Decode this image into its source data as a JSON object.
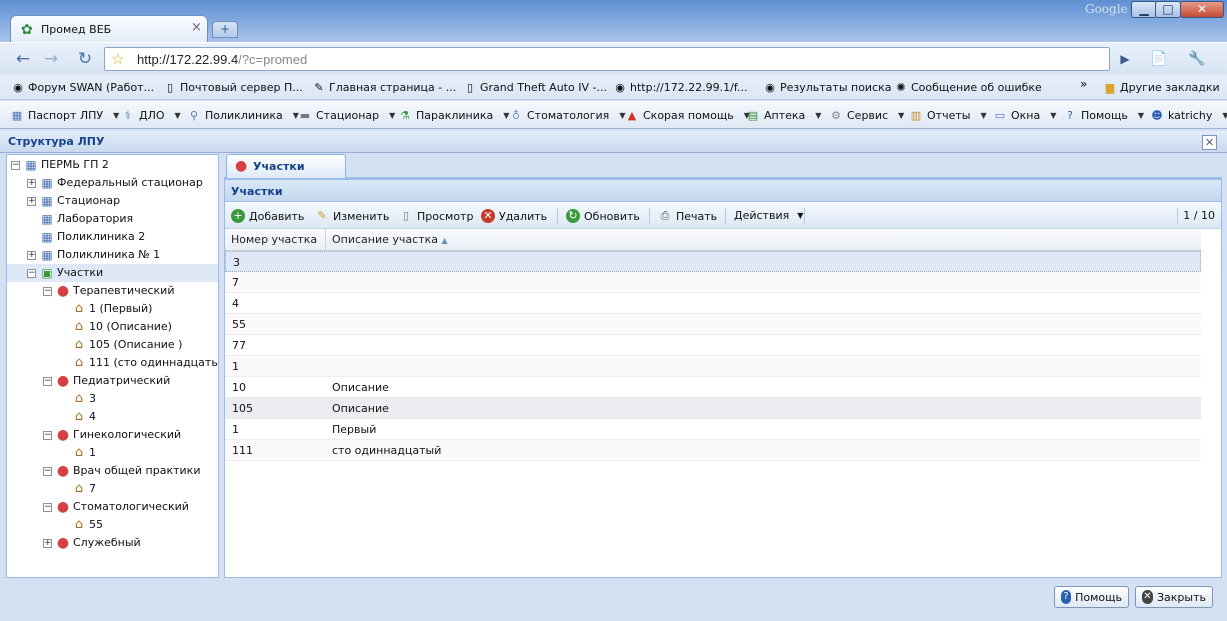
{
  "browser": {
    "tab_title": "Промед ВЕБ",
    "tab_close": "×",
    "new_tab": "+",
    "brand": "Google",
    "window_buttons": {
      "minimize": "▁",
      "maximize": "□",
      "close": "✕"
    },
    "url_host": "http://172.22.99.4",
    "url_path": "/?c=promed",
    "nav": {
      "back": "←",
      "forward": "→",
      "reload": "↻",
      "go": "▶",
      "page": "📄",
      "tools": "🔧"
    },
    "bookmarks": [
      {
        "label": "Форум SWAN (Работ...",
        "icon": "swan-icon"
      },
      {
        "label": "Почтовый сервер П...",
        "icon": "page-icon"
      },
      {
        "label": "Главная страница - ...",
        "icon": "wiki-icon"
      },
      {
        "label": "Grand Theft Auto IV -...",
        "icon": "page-icon"
      },
      {
        "label": "http://172.22.99.1/f...",
        "icon": "swan-icon"
      },
      {
        "label": "Результаты поиска",
        "icon": "swan-icon"
      },
      {
        "label": "Сообщение об ошибке",
        "icon": "bug-icon"
      }
    ],
    "bookmarks_more": "»",
    "other_bookmarks": "Другие закладки"
  },
  "menu": [
    {
      "label": "Паспорт ЛПУ",
      "icon": "passport-icon"
    },
    {
      "label": "ДЛО",
      "icon": "pills-icon"
    },
    {
      "label": "Поликлиника",
      "icon": "stethoscope-icon"
    },
    {
      "label": "Стационар",
      "icon": "bed-icon"
    },
    {
      "label": "Параклиника",
      "icon": "flask-icon"
    },
    {
      "label": "Стоматология",
      "icon": "tooth-icon"
    },
    {
      "label": "Скорая помощь",
      "icon": "siren-icon"
    },
    {
      "label": "Аптека",
      "icon": "pharmacy-icon"
    },
    {
      "label": "Сервис",
      "icon": "gear-icon"
    },
    {
      "label": "Отчеты",
      "icon": "report-icon"
    },
    {
      "label": "Окна",
      "icon": "windows-icon"
    },
    {
      "label": "Помощь",
      "icon": "help-icon"
    },
    {
      "label": "katrichy",
      "icon": "user-icon"
    }
  ],
  "panel": {
    "title": "Структура ЛПУ",
    "close": "✕"
  },
  "tree": {
    "root": "ПЕРМЬ ГП 2",
    "items": [
      {
        "label": "Федеральный стационар"
      },
      {
        "label": "Стационар"
      },
      {
        "label": "Лаборатория"
      },
      {
        "label": "Поликлиника 2"
      },
      {
        "label": "Поликлиника № 1"
      },
      {
        "label": "Участки"
      }
    ],
    "groups": [
      {
        "label": "Терапевтический",
        "children": [
          "1 (Первый)",
          "10 (Описание)",
          "105 (Описание )",
          "111 (сто одиннадцатый)"
        ]
      },
      {
        "label": "Педиатрический",
        "children": [
          "3",
          "4"
        ]
      },
      {
        "label": "Гинекологический",
        "children": [
          "1"
        ]
      },
      {
        "label": "Врач общей практики",
        "children": [
          "7"
        ]
      },
      {
        "label": "Стоматологический",
        "children": [
          "55"
        ]
      },
      {
        "label": "Служебный",
        "children": []
      }
    ]
  },
  "content": {
    "tab": "Участки",
    "grid_title": "Участки",
    "toolbar": {
      "add": "Добавить",
      "edit": "Изменить",
      "view": "Просмотр",
      "delete": "Удалить",
      "refresh": "Обновить",
      "print": "Печать",
      "actions": "Действия"
    },
    "pager": "1 / 10",
    "columns": [
      "Номер участка",
      "Описание участка"
    ],
    "rows": [
      [
        "3",
        ""
      ],
      [
        "7",
        ""
      ],
      [
        "4",
        ""
      ],
      [
        "55",
        ""
      ],
      [
        "77",
        ""
      ],
      [
        "1",
        ""
      ],
      [
        "10",
        "Описание"
      ],
      [
        "105",
        "Описание"
      ],
      [
        "1",
        "Первый"
      ],
      [
        "111",
        "сто одиннадцатый"
      ]
    ]
  },
  "footer": {
    "help": "Помощь",
    "close": "Закрыть"
  }
}
